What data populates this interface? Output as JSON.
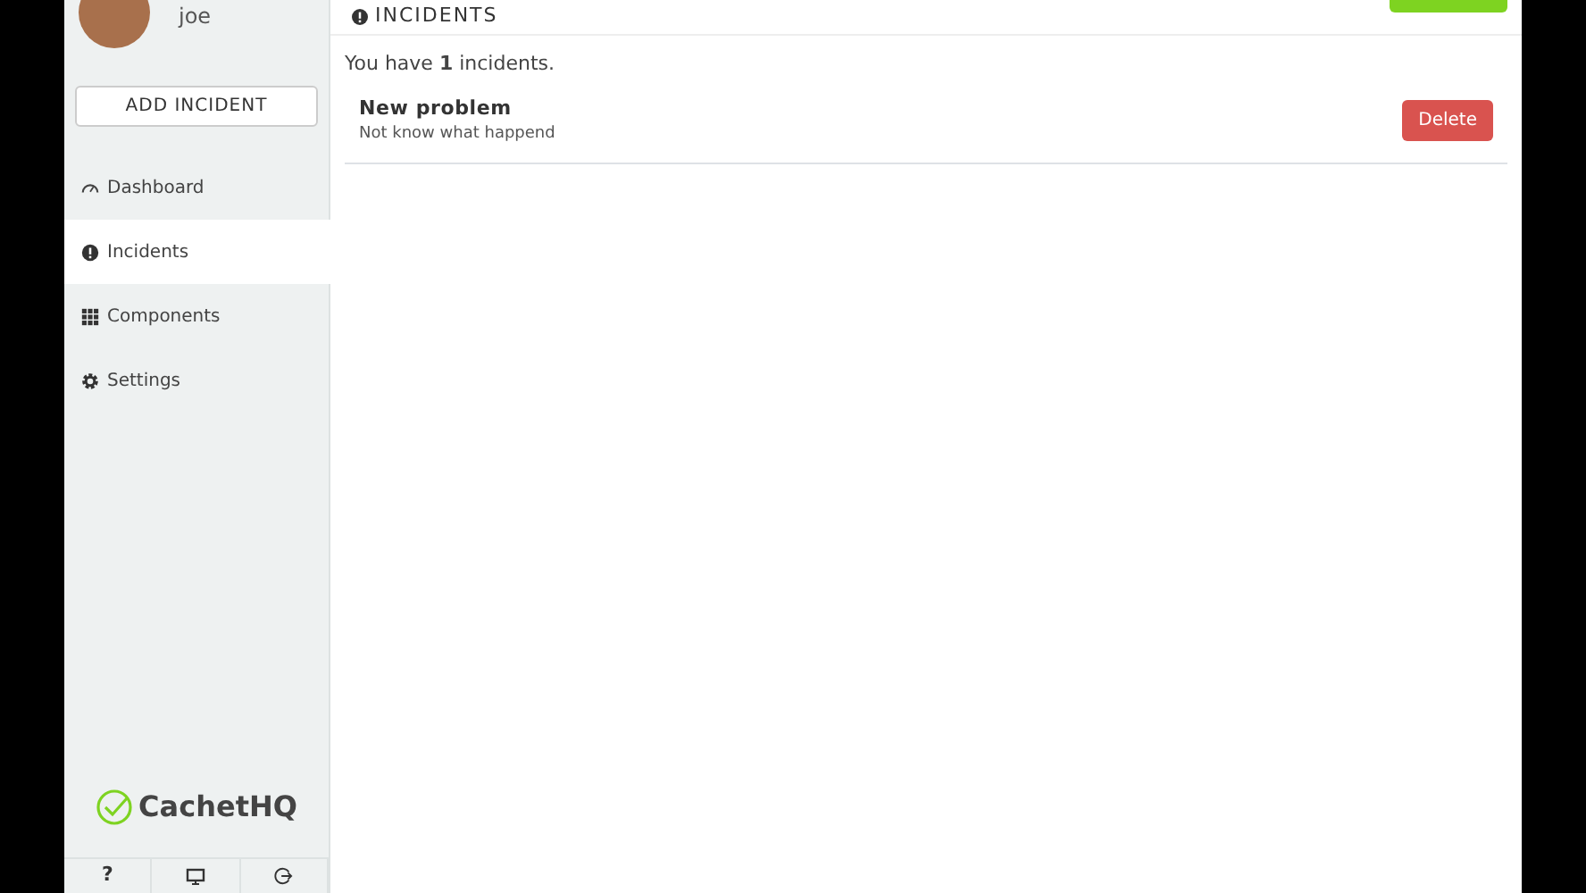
{
  "sidebar": {
    "user": {
      "name": "joe"
    },
    "add_button": "ADD INCIDENT",
    "items": [
      {
        "label": "Dashboard",
        "kind": "gauge",
        "selected": false
      },
      {
        "label": "Incidents",
        "kind": "alert",
        "selected": true
      },
      {
        "label": "Components",
        "kind": "grid",
        "selected": false
      },
      {
        "label": "Settings",
        "kind": "gear",
        "selected": false
      }
    ],
    "logo": "CachetHQ",
    "footer": [
      {
        "kind": "text",
        "label": "?"
      },
      {
        "kind": "monitor"
      },
      {
        "kind": "logout"
      }
    ]
  },
  "main": {
    "title": "INCIDENTS",
    "summary": "You have **1** incidents.",
    "incidents": [
      {
        "name": "New problem",
        "message": "Not know what happend",
        "action": "Delete"
      }
    ]
  }
}
